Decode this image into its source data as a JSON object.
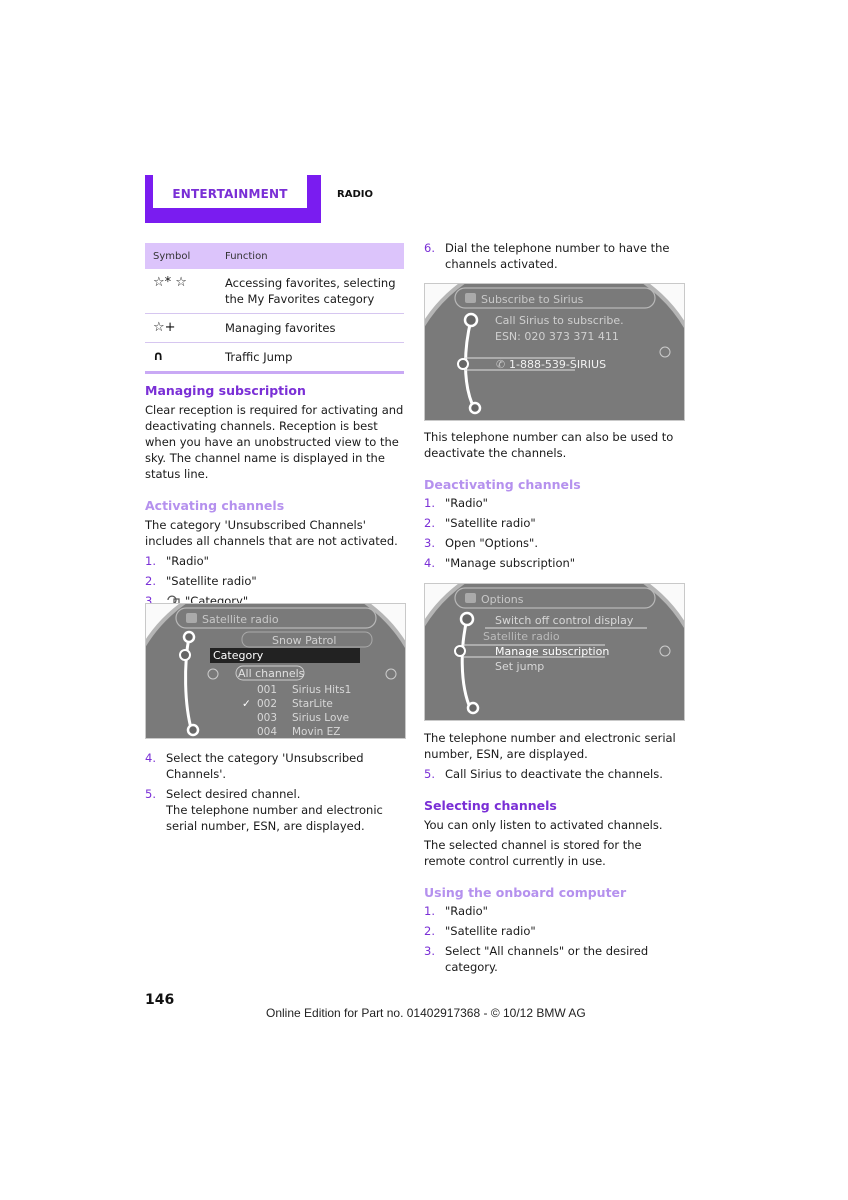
{
  "header": {
    "chapter": "ENTERTAINMENT",
    "section": "RADIO",
    "accent_color": "#7a1cf0"
  },
  "symbol_table": {
    "headers": [
      "Symbol",
      "Function"
    ],
    "rows": [
      {
        "symbol": "☆* ☆",
        "icon": "favorites-star-icon",
        "function": "Accessing favorites, selecting the My Favorites category"
      },
      {
        "symbol": "☆+",
        "icon": "manage-favorites-icon",
        "function": "Managing favorites"
      },
      {
        "symbol": "∩",
        "icon": "traffic-jump-icon",
        "function": "Traffic Jump"
      }
    ]
  },
  "left": {
    "managing_heading": "Managing subscription",
    "managing_text": "Clear reception is required for activating and deactivating channels. Reception is best when you have an unobstructed view to the sky. The channel name is displayed in the status line.",
    "activating_heading": "Activating channels",
    "activating_text": "The category 'Unsubscribed Channels' includes all channels that are not activated.",
    "steps_a": [
      {
        "n": "1.",
        "text": "\"Radio\""
      },
      {
        "n": "2.",
        "text": "\"Satellite radio\""
      },
      {
        "n": "3.",
        "text": "\"Category\"",
        "icon": "category-icon"
      }
    ],
    "screen1": {
      "title": "Satellite radio",
      "artist": "Snow Patrol",
      "highlight": "Category",
      "list_header": "All channels",
      "channels": [
        {
          "num": "001",
          "name": "Sirius Hits1"
        },
        {
          "num": "002",
          "name": "StarLite",
          "checked": true
        },
        {
          "num": "003",
          "name": "Sirius Love"
        },
        {
          "num": "004",
          "name": "Movin EZ"
        }
      ]
    },
    "steps_b": [
      {
        "n": "4.",
        "text": "Select the category 'Unsubscribed Channels'."
      },
      {
        "n": "5.",
        "text": "Select desired channel.",
        "sub": "The telephone number and electronic serial number, ESN, are displayed."
      }
    ]
  },
  "right": {
    "step6": {
      "n": "6.",
      "text": "Dial the telephone number to have the channels activated."
    },
    "screen2": {
      "title": "Subscribe to Sirius",
      "line1": "Call Sirius to subscribe.",
      "line2": "ESN: 020 373 371 411",
      "phone": "1-888-539-SIRIUS"
    },
    "after_screen2": "This telephone number can also be used to deactivate the channels.",
    "deactivating_heading": "Deactivating channels",
    "steps_d": [
      {
        "n": "1.",
        "text": "\"Radio\""
      },
      {
        "n": "2.",
        "text": "\"Satellite radio\""
      },
      {
        "n": "3.",
        "text": "Open \"Options\"."
      },
      {
        "n": "4.",
        "text": "\"Manage subscription\""
      }
    ],
    "screen3": {
      "title": "Options",
      "items": [
        "Switch off control display",
        "Satellite radio",
        "Manage subscription",
        "Set jump"
      ]
    },
    "after_screen3": "The telephone number and electronic serial number, ESN, are displayed.",
    "step5": {
      "n": "5.",
      "text": "Call Sirius to deactivate the channels."
    },
    "selecting_heading": "Selecting channels",
    "selecting_p1": "You can only listen to activated channels.",
    "selecting_p2": "The selected channel is stored for the remote control currently in use.",
    "onboard_heading": "Using the onboard computer",
    "steps_o": [
      {
        "n": "1.",
        "text": "\"Radio\""
      },
      {
        "n": "2.",
        "text": "\"Satellite radio\""
      },
      {
        "n": "3.",
        "text": "Select \"All channels\" or the desired category."
      }
    ]
  },
  "footer": {
    "page_number": "146",
    "edition": "Online Edition for Part no. 01402917368 - © 10/12 BMW AG"
  }
}
